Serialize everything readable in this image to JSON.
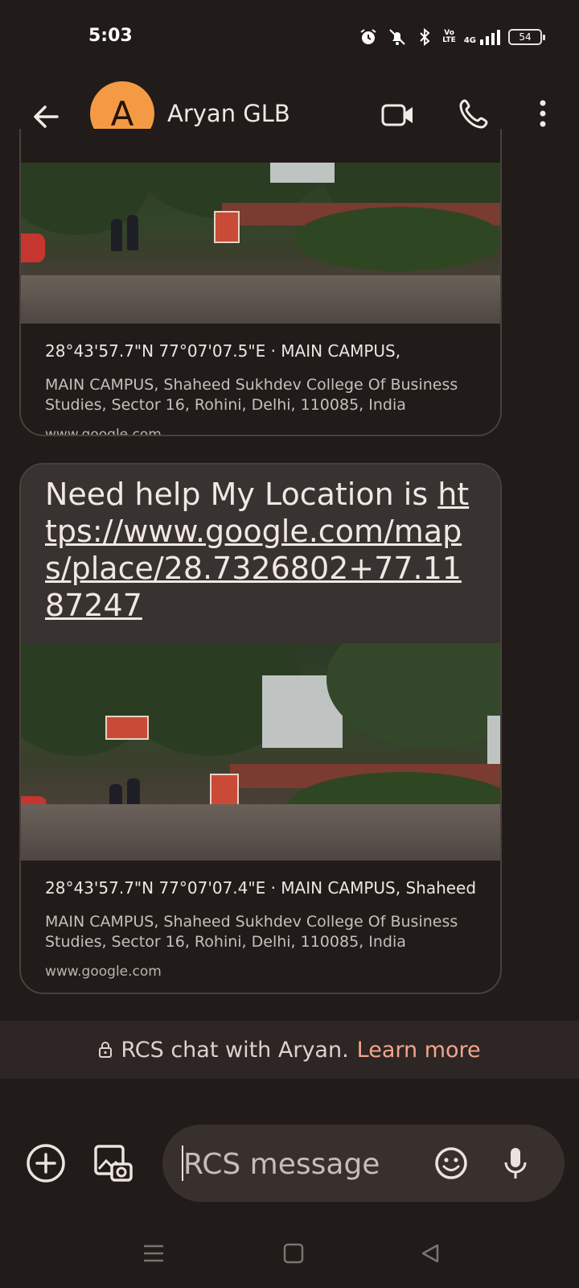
{
  "status_bar": {
    "time": "5:03",
    "vo_label": "Vo",
    "lte_label": "LTE",
    "network_label": "4G",
    "battery": "54"
  },
  "header": {
    "avatar_letter": "A",
    "contact_name": "Aryan GLB",
    "avatar_color": "#f59a44"
  },
  "messages": [
    {
      "type": "location_card",
      "location_title": "28°43'57.7\"N 77°07'07.5\"E · MAIN CAMPUS,",
      "address": "MAIN CAMPUS, Shaheed Sukhdev College Of Business Studies, Sector 16, Rohini, Delhi, 110085, India",
      "domain": "www.google.com"
    },
    {
      "type": "text_with_location",
      "text_prefix": "Need help My Location is ",
      "link": "https://www.google.com/maps/place/28.7326802+77.1187247",
      "location_title": "28°43'57.7\"N 77°07'07.4\"E · MAIN CAMPUS, Shaheed",
      "address": "MAIN CAMPUS, Shaheed Sukhdev College Of Business Studies, Sector 16, Rohini, Delhi, 110085, India",
      "domain": "www.google.com"
    }
  ],
  "rcs_banner": {
    "text": "RCS chat with Aryan.",
    "link_text": "Learn more",
    "link_color": "#f2a48b"
  },
  "composer": {
    "placeholder": "RCS message"
  },
  "icons": {
    "back": "arrow-back-icon",
    "video": "video-camera-icon",
    "call": "phone-icon",
    "more": "more-vertical-icon",
    "add": "add-circle-icon",
    "gallery": "gallery-icon",
    "emoji": "emoji-icon",
    "mic": "microphone-icon",
    "lock": "lock-icon"
  }
}
